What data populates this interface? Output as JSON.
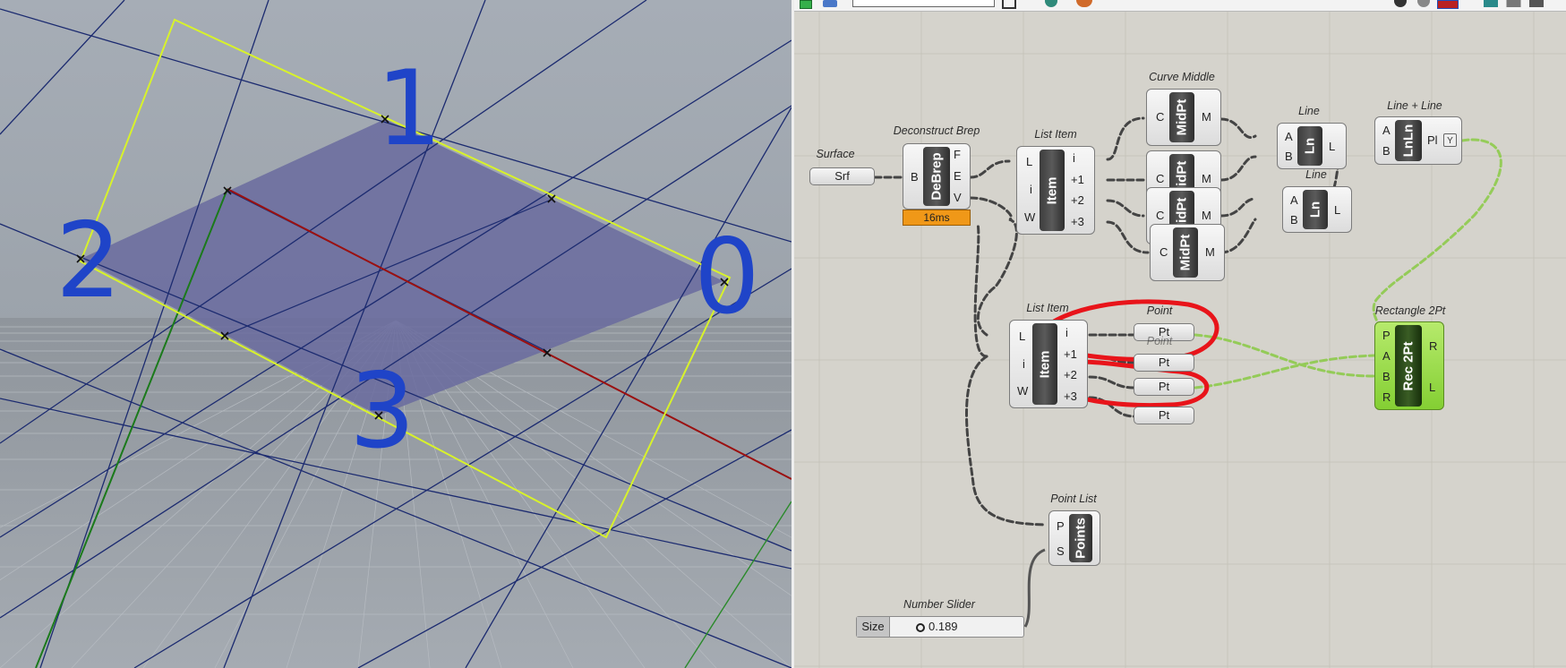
{
  "viewport": {
    "corner_labels": [
      "0",
      "1",
      "2",
      "3"
    ]
  },
  "toolbar": {
    "icons": [
      "green-square-icon",
      "toggle-icon",
      "search-box",
      "bracket-icon",
      "sphere-icon",
      "palette-icon",
      "eye-icon",
      "disk-icon",
      "red-disk-icon",
      "ball-icons"
    ]
  },
  "components": {
    "surface": {
      "title": "Surface",
      "label": "Srf"
    },
    "deconstruct_brep": {
      "title": "Deconstruct Brep",
      "label": "DeBrep",
      "inputs": [
        "B"
      ],
      "outputs": [
        "F",
        "E",
        "V"
      ],
      "profiler": "16ms"
    },
    "list_item_top": {
      "title": "List Item",
      "label": "Item",
      "inputs": [
        "L",
        "i",
        "W"
      ],
      "outputs": [
        "i",
        "+1",
        "+2",
        "+3"
      ]
    },
    "curve_middle": {
      "title": "Curve Middle",
      "label": "MidPt",
      "input": "C",
      "output": "M"
    },
    "line_1": {
      "title": "Line",
      "label": "Ln",
      "inputs": [
        "A",
        "B"
      ],
      "output": "L"
    },
    "line_2": {
      "title": "Line",
      "label": "Ln",
      "inputs": [
        "A",
        "B"
      ],
      "output": "L"
    },
    "line_line": {
      "title": "Line + Line",
      "label": "LnLn",
      "inputs": [
        "A",
        "B"
      ],
      "output": "Pl",
      "toggle": "Y"
    },
    "list_item_bottom": {
      "title": "List Item",
      "label": "Item",
      "inputs": [
        "L",
        "i",
        "W"
      ],
      "outputs": [
        "i",
        "+1",
        "+2",
        "+3"
      ]
    },
    "point": {
      "title": "Point",
      "label": "Pt",
      "title_partial": "Point"
    },
    "rectangle_2pt": {
      "title": "Rectangle 2Pt",
      "label": "Rec 2Pt",
      "inputs": [
        "P",
        "A",
        "B",
        "R"
      ],
      "outputs": [
        "R",
        "L"
      ]
    },
    "point_list": {
      "title": "Point List",
      "label": "Points",
      "inputs": [
        "P",
        "S"
      ]
    },
    "number_slider": {
      "title": "Number Slider",
      "label": "Size",
      "value": "0.189"
    }
  },
  "colors": {
    "canvas_bg": "#d5d3cc",
    "viewport_bg": "#a2a9b2",
    "wire_selected": "#8ecb4c",
    "annotation": "#e8141a",
    "axis_x": "#9b1010",
    "axis_y": "#1b7a1b",
    "rect_outline": "#d8f22a",
    "label_blue": "#1f44c8"
  }
}
